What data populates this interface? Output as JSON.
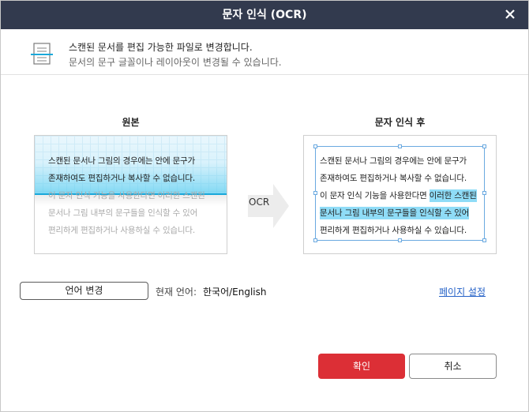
{
  "dialog": {
    "title": "문자 인식 (OCR)"
  },
  "info": {
    "line1": "스캔된 문서를 편집 가능한 파일로 변경합니다.",
    "line2": "문서의 문구 글꼴이나 레이아웃이 변경될 수 있습니다."
  },
  "original": {
    "title": "원본",
    "lines": [
      "스캔된 문서나 그림의 경우에는 안에 문구가",
      "존재하여도 편집하거나 복사할 수 없습니다.",
      "이 문자 인식 기능을 사용한다면 이러한 스캔된",
      "문서나 그림 내부의 문구들을 인식할 수 있어",
      "편리하게 편집하거나 사용하실 수 있습니다."
    ]
  },
  "arrow": {
    "label": "OCR"
  },
  "result": {
    "title": "문자 인식 후",
    "line1": "스캔된 문서나 그림의 경우에는 안에 문구가",
    "line2": "존재하여도 편집하거나 복사할 수 없습니다.",
    "line3_plain": "이 문자 인식 기능을 사용한다면 ",
    "line3_highlight": "이러한 스캔된",
    "line4_highlight": "문서나 그림 내부의 문구들을 인식할 수 있어",
    "line5": "편리하게 편집하거나 사용하실 수 있습니다."
  },
  "language": {
    "button_label": "언어 변경",
    "current_label": "현재 언어:",
    "current_value": "한국어/English"
  },
  "page_settings_link": "페이지 설정",
  "buttons": {
    "ok": "확인",
    "cancel": "취소"
  },
  "colors": {
    "titlebar": "#323a4e",
    "primary_button": "#dc2f36",
    "highlight": "#8fdcf7",
    "link": "#2461c7"
  },
  "icons": {
    "close": "close-icon",
    "document": "document-scan-icon",
    "arrow": "arrow-right-icon"
  }
}
